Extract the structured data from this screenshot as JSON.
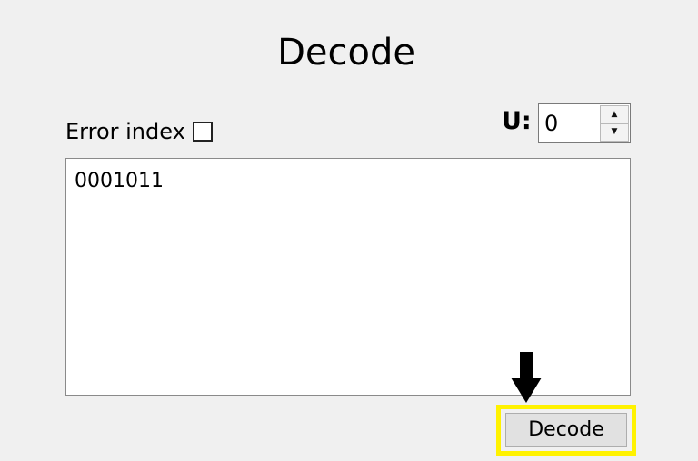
{
  "header": {
    "title": "Decode"
  },
  "options": {
    "error_index_label": "Error index",
    "error_index_checked": false,
    "u_label": "U:",
    "u_value": "0"
  },
  "input": {
    "text": "0001011"
  },
  "actions": {
    "decode_label": "Decode"
  },
  "colors": {
    "background": "#f0f0f0",
    "highlight": "#fff200",
    "arrow": "#000000"
  },
  "icons": {
    "spin_up": "spin-up-icon",
    "spin_down": "spin-down-icon",
    "pointer": "arrow-down-icon"
  }
}
